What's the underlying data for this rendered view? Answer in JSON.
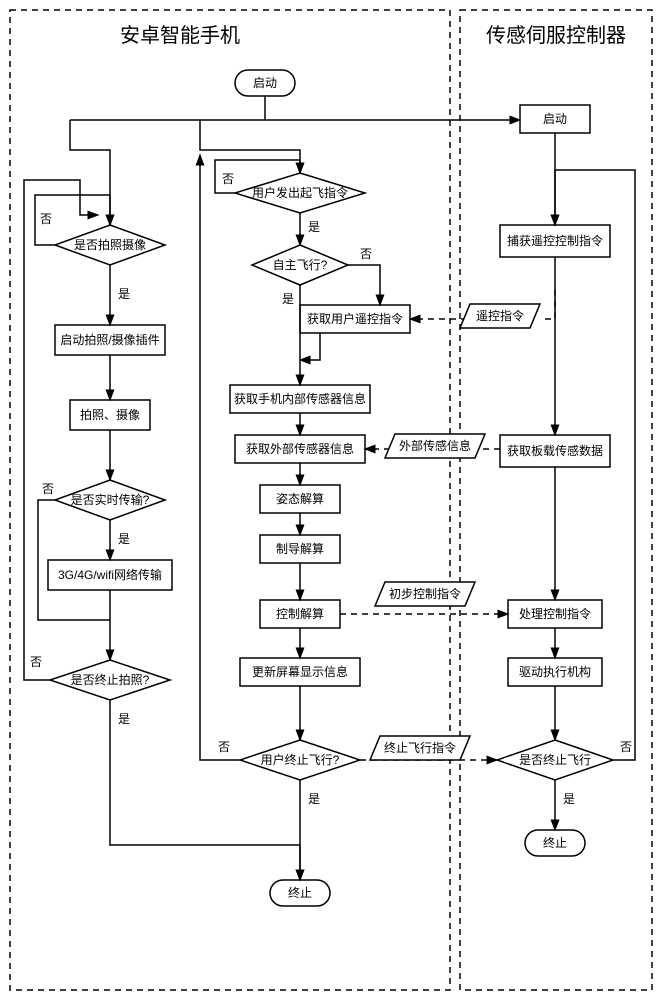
{
  "titles": {
    "left": "安卓智能手机",
    "right": "传感伺服控制器"
  },
  "nodes": {
    "start_l": "启动",
    "photo_q": "是否拍照摄像",
    "photo_start": "启动拍照/摄像插件",
    "photo_do": "拍照、摄像",
    "realtime_q": "是否实时传输?",
    "net_tx": "3G/4G/wifi网络传输",
    "stop_photo_q": "是否终止拍照?",
    "takeoff_q": "用户发出起飞指令",
    "auto_q": "自主飞行?",
    "get_user_rc": "获取用户遥控指令",
    "get_internal": "获取手机内部传感器信息",
    "get_external": "获取外部传感器信息",
    "attitude": "姿态解算",
    "guidance": "制导解算",
    "control": "控制解算",
    "update_screen": "更新屏幕显示信息",
    "user_stop_q": "用户终止飞行?",
    "end_l": "终止",
    "start_r": "启动",
    "capture_rc": "捕获遥控控制指令",
    "get_onboard": "获取板载传感数据",
    "proc_ctrl": "处理控制指令",
    "drive": "驱动执行机构",
    "stop_fly_q": "是否终止飞行",
    "end_r": "终止"
  },
  "labels": {
    "yes": "是",
    "no": "否",
    "rc_cmd": "遥控指令",
    "ext_sensor": "外部传感信息",
    "prelim_ctrl": "初步控制指令",
    "stop_fly_cmd": "终止飞行指令"
  },
  "chart_data": {
    "type": "flowchart",
    "panels": [
      {
        "id": "left",
        "title": "安卓智能手机"
      },
      {
        "id": "right",
        "title": "传感伺服控制器"
      }
    ],
    "nodes": [
      {
        "id": "start_l",
        "panel": "left",
        "type": "terminator",
        "label": "启动"
      },
      {
        "id": "photo_q",
        "panel": "left",
        "type": "decision",
        "label": "是否拍照摄像"
      },
      {
        "id": "photo_start",
        "panel": "left",
        "type": "process",
        "label": "启动拍照/摄像插件"
      },
      {
        "id": "photo_do",
        "panel": "left",
        "type": "process",
        "label": "拍照、摄像"
      },
      {
        "id": "realtime_q",
        "panel": "left",
        "type": "decision",
        "label": "是否实时传输?"
      },
      {
        "id": "net_tx",
        "panel": "left",
        "type": "process",
        "label": "3G/4G/wifi网络传输"
      },
      {
        "id": "stop_photo_q",
        "panel": "left",
        "type": "decision",
        "label": "是否终止拍照?"
      },
      {
        "id": "takeoff_q",
        "panel": "left",
        "type": "decision",
        "label": "用户发出起飞指令"
      },
      {
        "id": "auto_q",
        "panel": "left",
        "type": "decision",
        "label": "自主飞行?"
      },
      {
        "id": "get_user_rc",
        "panel": "left",
        "type": "process",
        "label": "获取用户遥控指令"
      },
      {
        "id": "get_internal",
        "panel": "left",
        "type": "process",
        "label": "获取手机内部传感器信息"
      },
      {
        "id": "get_external",
        "panel": "left",
        "type": "process",
        "label": "获取外部传感器信息"
      },
      {
        "id": "attitude",
        "panel": "left",
        "type": "process",
        "label": "姿态解算"
      },
      {
        "id": "guidance",
        "panel": "left",
        "type": "process",
        "label": "制导解算"
      },
      {
        "id": "control",
        "panel": "left",
        "type": "process",
        "label": "控制解算"
      },
      {
        "id": "update_screen",
        "panel": "left",
        "type": "process",
        "label": "更新屏幕显示信息"
      },
      {
        "id": "user_stop_q",
        "panel": "left",
        "type": "decision",
        "label": "用户终止飞行?"
      },
      {
        "id": "end_l",
        "panel": "left",
        "type": "terminator",
        "label": "终止"
      },
      {
        "id": "start_r",
        "panel": "right",
        "type": "process",
        "label": "启动"
      },
      {
        "id": "capture_rc",
        "panel": "right",
        "type": "process",
        "label": "捕获遥控控制指令"
      },
      {
        "id": "get_onboard",
        "panel": "right",
        "type": "process",
        "label": "获取板载传感数据"
      },
      {
        "id": "proc_ctrl",
        "panel": "right",
        "type": "process",
        "label": "处理控制指令"
      },
      {
        "id": "drive",
        "panel": "right",
        "type": "process",
        "label": "驱动执行机构"
      },
      {
        "id": "stop_fly_q",
        "panel": "right",
        "type": "decision",
        "label": "是否终止飞行"
      },
      {
        "id": "end_r",
        "panel": "right",
        "type": "terminator",
        "label": "终止"
      }
    ],
    "edges": [
      {
        "from": "start_l",
        "to": "photo_q",
        "style": "solid"
      },
      {
        "from": "start_l",
        "to": "takeoff_q",
        "style": "solid"
      },
      {
        "from": "start_l",
        "to": "start_r",
        "style": "solid"
      },
      {
        "from": "photo_q",
        "to": "photo_start",
        "label": "是",
        "style": "solid"
      },
      {
        "from": "photo_q",
        "to": "photo_q",
        "label": "否",
        "style": "solid",
        "loop": true
      },
      {
        "from": "photo_start",
        "to": "photo_do",
        "style": "solid"
      },
      {
        "from": "photo_do",
        "to": "realtime_q",
        "style": "solid"
      },
      {
        "from": "realtime_q",
        "to": "net_tx",
        "label": "是",
        "style": "solid"
      },
      {
        "from": "realtime_q",
        "to": "stop_photo_q",
        "label": "否",
        "style": "solid"
      },
      {
        "from": "net_tx",
        "to": "stop_photo_q",
        "style": "solid"
      },
      {
        "from": "stop_photo_q",
        "to": "photo_q",
        "label": "否",
        "style": "solid"
      },
      {
        "from": "stop_photo_q",
        "to": "end_l",
        "label": "是",
        "style": "solid"
      },
      {
        "from": "takeoff_q",
        "to": "auto_q",
        "label": "是",
        "style": "solid"
      },
      {
        "from": "takeoff_q",
        "to": "takeoff_q",
        "label": "否",
        "style": "solid",
        "loop": true
      },
      {
        "from": "auto_q",
        "to": "get_internal",
        "label": "是",
        "style": "solid"
      },
      {
        "from": "auto_q",
        "to": "get_user_rc",
        "label": "否",
        "style": "solid"
      },
      {
        "from": "get_user_rc",
        "to": "get_internal",
        "style": "solid"
      },
      {
        "from": "get_internal",
        "to": "get_external",
        "style": "solid"
      },
      {
        "from": "get_external",
        "to": "attitude",
        "style": "solid"
      },
      {
        "from": "attitude",
        "to": "guidance",
        "style": "solid"
      },
      {
        "from": "guidance",
        "to": "control",
        "style": "solid"
      },
      {
        "from": "control",
        "to": "update_screen",
        "style": "solid"
      },
      {
        "from": "update_screen",
        "to": "user_stop_q",
        "style": "solid"
      },
      {
        "from": "user_stop_q",
        "to": "end_l",
        "label": "是",
        "style": "solid"
      },
      {
        "from": "user_stop_q",
        "to": "takeoff_q",
        "label": "否",
        "style": "solid"
      },
      {
        "from": "start_r",
        "to": "capture_rc",
        "style": "solid"
      },
      {
        "from": "capture_rc",
        "to": "get_user_rc",
        "label": "遥控指令",
        "style": "dashed"
      },
      {
        "from": "capture_rc",
        "to": "get_onboard",
        "style": "solid"
      },
      {
        "from": "get_onboard",
        "to": "get_external",
        "label": "外部传感信息",
        "style": "dashed"
      },
      {
        "from": "get_onboard",
        "to": "proc_ctrl",
        "style": "solid"
      },
      {
        "from": "control",
        "to": "proc_ctrl",
        "label": "初步控制指令",
        "style": "dashed"
      },
      {
        "from": "proc_ctrl",
        "to": "drive",
        "style": "solid"
      },
      {
        "from": "drive",
        "to": "stop_fly_q",
        "style": "solid"
      },
      {
        "from": "user_stop_q",
        "to": "stop_fly_q",
        "label": "终止飞行指令",
        "style": "dashed"
      },
      {
        "from": "stop_fly_q",
        "to": "end_r",
        "label": "是",
        "style": "solid"
      },
      {
        "from": "stop_fly_q",
        "to": "capture_rc",
        "label": "否",
        "style": "solid"
      }
    ]
  }
}
